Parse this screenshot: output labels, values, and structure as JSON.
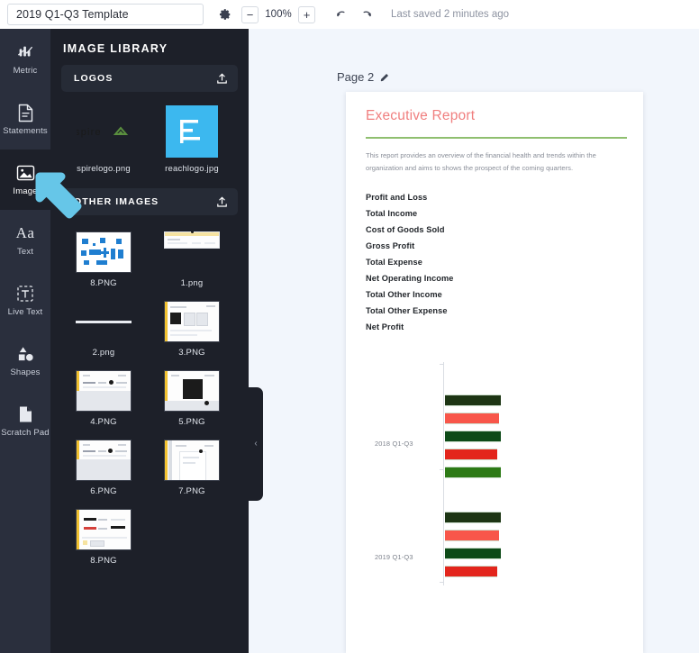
{
  "topbar": {
    "doc_title": "2019 Q1-Q3 Template",
    "gear_icon": "gear-icon",
    "zoom_out_label": "−",
    "zoom_level": "100%",
    "zoom_in_label": "+",
    "undo_icon": "undo-icon",
    "redo_icon": "redo-icon",
    "save_status": "Last saved 2 minutes ago"
  },
  "sidebar": {
    "items": [
      {
        "label": "Metric",
        "icon": "metric-icon",
        "active": false
      },
      {
        "label": "Statements",
        "icon": "document-icon",
        "active": false
      },
      {
        "label": "Image",
        "icon": "image-icon",
        "active": true
      },
      {
        "label": "Text",
        "icon": "text-aa-icon",
        "active": false
      },
      {
        "label": "Live Text",
        "icon": "live-text-icon",
        "active": false
      },
      {
        "label": "Shapes",
        "icon": "shapes-icon",
        "active": false
      },
      {
        "label": "Scratch Pad",
        "icon": "scratch-pad-icon",
        "active": false
      }
    ]
  },
  "library": {
    "title": "IMAGE LIBRARY",
    "sections": [
      {
        "name": "LOGOS",
        "upload_icon": "upload-icon"
      },
      {
        "name": "OTHER IMAGES",
        "upload_icon": "upload-icon"
      }
    ],
    "logos": [
      {
        "name": "spirelogo.png"
      },
      {
        "name": "reachlogo.jpg"
      }
    ],
    "other_images": [
      {
        "name": "8.PNG"
      },
      {
        "name": "1.png"
      },
      {
        "name": "2.png"
      },
      {
        "name": "3.PNG"
      },
      {
        "name": "4.PNG"
      },
      {
        "name": "5.PNG"
      },
      {
        "name": "6.PNG"
      },
      {
        "name": "7.PNG"
      },
      {
        "name": "8.PNG"
      }
    ]
  },
  "collapse_handle": {
    "chevron": "‹"
  },
  "document": {
    "page_label": "Page 2",
    "edit_icon": "pencil-icon",
    "report_title": "Executive Report",
    "paragraph": "This report provides an overview of the financial health and trends within the organization and aims to shows the prospect of the coming quarters.",
    "table_rows": [
      "Profit and Loss",
      "Total Income",
      "Cost of Goods Sold",
      "Gross Profit",
      "Total Expense",
      "Net Operating Income",
      "Total Other Income",
      "Total Other Expense",
      "Net Profit"
    ],
    "chart_data": {
      "type": "bar",
      "orientation": "horizontal",
      "title": "",
      "xlabel": "",
      "ylabel": "",
      "grid": false,
      "legend_position": "none",
      "categories": [
        "2018 Q1-Q3",
        "2019 Q1-Q3"
      ],
      "series": [
        {
          "name": "Total Income",
          "color": "#1d3514",
          "values": [
            62,
            62
          ]
        },
        {
          "name": "Cost of Goods Sold",
          "color": "#f8564a",
          "values": [
            60,
            60
          ]
        },
        {
          "name": "Gross Profit",
          "color": "#0d4a17",
          "values": [
            62,
            62
          ]
        },
        {
          "name": "Total Expense",
          "color": "#e3251c",
          "values": [
            58,
            58
          ]
        },
        {
          "name": "Net Profit",
          "color": "#2d7a16",
          "values": [
            62,
            62
          ]
        }
      ]
    }
  },
  "cursor": {
    "icon": "arrow-cursor",
    "color": "#66c6e8"
  }
}
